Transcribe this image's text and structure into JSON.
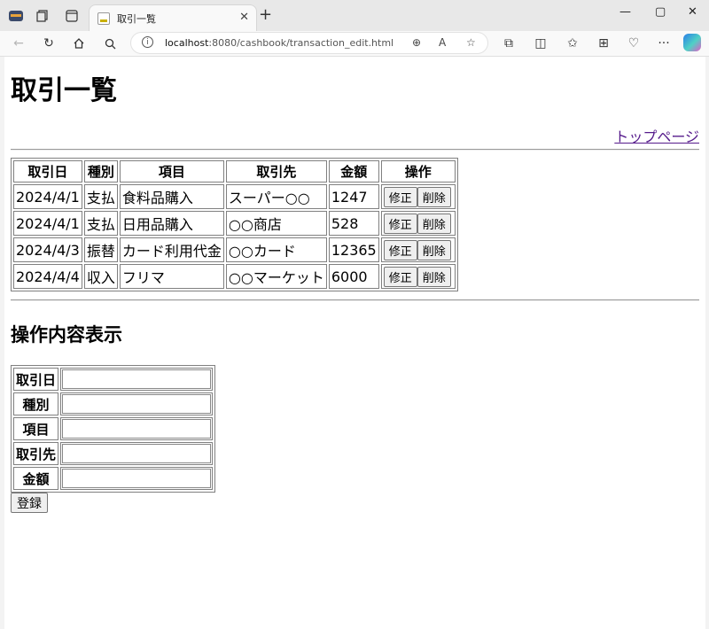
{
  "browser": {
    "tab_title": "取引一覧",
    "url_host": "localhost",
    "url_rest": ":8080/cashbook/transaction_edit.html"
  },
  "page": {
    "heading": "取引一覧",
    "top_link": "トップページ",
    "table": {
      "headers": [
        "取引日",
        "種別",
        "項目",
        "取引先",
        "金額",
        "操作"
      ],
      "rows": [
        [
          "2024/4/1",
          "支払",
          "食料品購入",
          "スーパー○○",
          "1247"
        ],
        [
          "2024/4/1",
          "支払",
          "日用品購入",
          "○○商店",
          "528"
        ],
        [
          "2024/4/3",
          "振替",
          "カード利用代金",
          "○○カード",
          "12365"
        ],
        [
          "2024/4/4",
          "収入",
          "フリマ",
          "○○マーケット",
          "6000"
        ]
      ],
      "edit_label": "修正",
      "delete_label": "削除"
    },
    "section_heading": "操作内容表示",
    "form": {
      "fields": [
        "取引日",
        "種別",
        "項目",
        "取引先",
        "金額"
      ],
      "values": [
        "",
        "",
        "",
        "",
        ""
      ],
      "submit_label": "登録"
    }
  }
}
